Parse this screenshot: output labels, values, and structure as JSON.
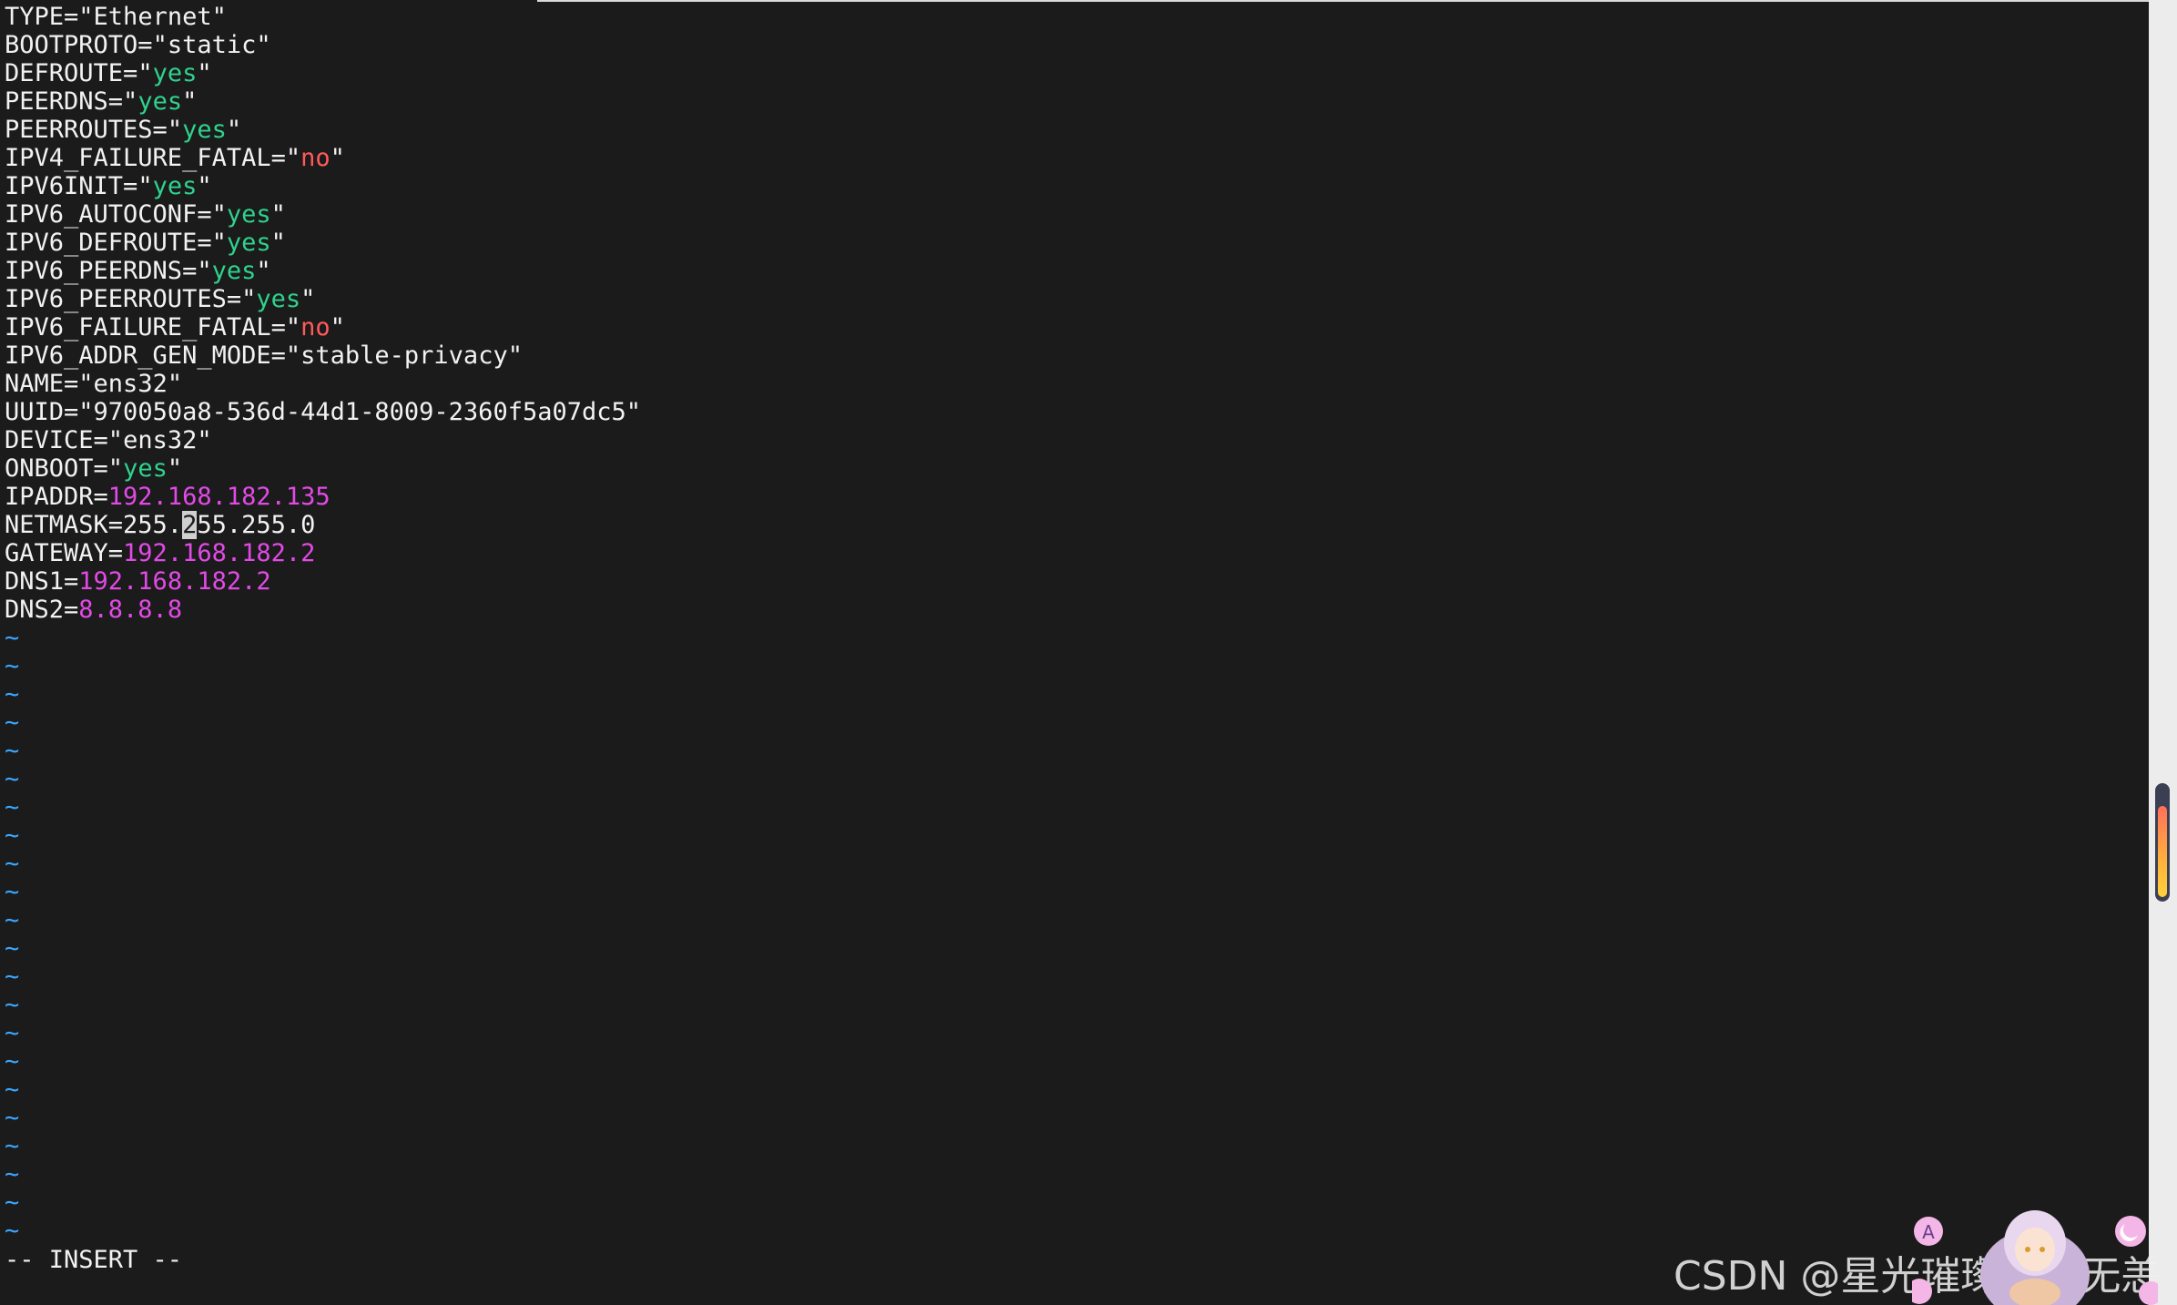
{
  "editor": {
    "lines": [
      {
        "key": "TYPE=",
        "open": "\"",
        "value": "Ethernet",
        "close": "\"",
        "value_color": "plain"
      },
      {
        "key": "BOOTPROTO=",
        "open": "\"",
        "value": "static",
        "close": "\"",
        "value_color": "plain"
      },
      {
        "key": "DEFROUTE=",
        "open": "\"",
        "value": "yes",
        "close": "\"",
        "value_color": "green"
      },
      {
        "key": "PEERDNS=",
        "open": "\"",
        "value": "yes",
        "close": "\"",
        "value_color": "green"
      },
      {
        "key": "PEERROUTES=",
        "open": "\"",
        "value": "yes",
        "close": "\"",
        "value_color": "green"
      },
      {
        "key": "IPV4_FAILURE_FATAL=",
        "open": "\"",
        "value": "no",
        "close": "\"",
        "value_color": "red"
      },
      {
        "key": "IPV6INIT=",
        "open": "\"",
        "value": "yes",
        "close": "\"",
        "value_color": "green"
      },
      {
        "key": "IPV6_AUTOCONF=",
        "open": "\"",
        "value": "yes",
        "close": "\"",
        "value_color": "green"
      },
      {
        "key": "IPV6_DEFROUTE=",
        "open": "\"",
        "value": "yes",
        "close": "\"",
        "value_color": "green"
      },
      {
        "key": "IPV6_PEERDNS=",
        "open": "\"",
        "value": "yes",
        "close": "\"",
        "value_color": "green"
      },
      {
        "key": "IPV6_PEERROUTES=",
        "open": "\"",
        "value": "yes",
        "close": "\"",
        "value_color": "green"
      },
      {
        "key": "IPV6_FAILURE_FATAL=",
        "open": "\"",
        "value": "no",
        "close": "\"",
        "value_color": "red"
      },
      {
        "key": "IPV6_ADDR_GEN_MODE=",
        "open": "\"",
        "value": "stable-privacy",
        "close": "\"",
        "value_color": "plain"
      },
      {
        "key": "NAME=",
        "open": "\"",
        "value": "ens32",
        "close": "\"",
        "value_color": "plain"
      },
      {
        "key": "UUID=",
        "open": "\"",
        "value": "970050a8-536d-44d1-8009-2360f5a07dc5",
        "close": "\"",
        "value_color": "plain"
      },
      {
        "key": "DEVICE=",
        "open": "\"",
        "value": "ens32",
        "close": "\"",
        "value_color": "plain"
      },
      {
        "key": "ONBOOT=",
        "open": "\"",
        "value": "yes",
        "close": "\"",
        "value_color": "green"
      },
      {
        "key": "IPADDR=",
        "open": "",
        "value": "192.168.182.135",
        "close": "",
        "value_color": "magenta"
      },
      {
        "key": "NETMASK=255.",
        "open": "",
        "value": "",
        "close": "",
        "value_color": "plain",
        "cursor_char": "2",
        "after_cursor": "55.255.0"
      },
      {
        "key": "GATEWAY=",
        "open": "",
        "value": "192.168.182.2",
        "close": "",
        "value_color": "magenta"
      },
      {
        "key": "DNS1=",
        "open": "",
        "value": "192.168.182.2",
        "close": "",
        "value_color": "magenta"
      },
      {
        "key": "DNS2=",
        "open": "",
        "value": "8.8.8.8",
        "close": "",
        "value_color": "magenta"
      }
    ],
    "empty_line_marker": "~",
    "empty_line_count": 22,
    "mode": "-- INSERT --"
  },
  "watermark": {
    "text": "CSDN @星光璀璨山河无恙"
  },
  "colors": {
    "background": "#1b1b1b",
    "text": "#f2f2f2",
    "green": "#2fd28e",
    "red": "#ff5a5a",
    "magenta": "#e24ae6",
    "tilde": "#3aa6ff"
  }
}
